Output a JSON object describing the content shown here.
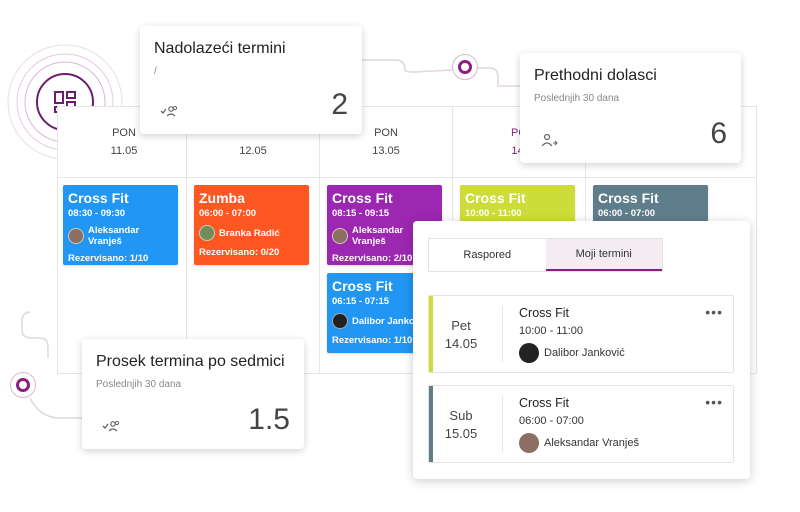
{
  "calendar": {
    "days": [
      {
        "name": "PON",
        "date": "11.05"
      },
      {
        "name": "",
        "date": "12.05"
      },
      {
        "name": "PON",
        "date": "13.05"
      },
      {
        "name": "PO",
        "date": "14."
      },
      {
        "name": "",
        "date": ""
      }
    ],
    "events": [
      {
        "title": "Cross Fit",
        "time": "08:30 - 09:30",
        "trainer": "Aleksandar Vranješ",
        "reserved": "Rezervisano: 1/10",
        "color": "#2196f3"
      },
      {
        "title": "Zumba",
        "time": "06:00 - 07:00",
        "trainer": "Branka Radić",
        "reserved": "Rezervisano: 0/20",
        "color": "#ff5722"
      },
      {
        "title": "Cross Fit",
        "time": "08:15 - 09:15",
        "trainer": "Aleksandar Vranješ",
        "reserved": "Rezervisano: 2/10",
        "color": "#9c27b0"
      },
      {
        "title": "Cross Fit",
        "time": "06:15 - 07:15",
        "trainer": "Dalibor Janković",
        "reserved": "Rezervisano: 1/10",
        "color": "#2196f3"
      },
      {
        "title": "Cross Fit",
        "time": "10:00 - 11:00",
        "color": "#cddc39"
      },
      {
        "title": "Cross Fit",
        "time": "06:00 - 07:00",
        "color": "#607d8b"
      }
    ]
  },
  "cards": {
    "upcoming": {
      "title": "Nadolazeći termini",
      "subtitle": "/",
      "value": "2",
      "icon": "group-check-icon"
    },
    "previous": {
      "title": "Prethodni dolasci",
      "subtitle": "Poslednjih 30 dana",
      "value": "6",
      "icon": "person-arrow-icon"
    },
    "average": {
      "title": "Prosek termina po sedmici",
      "subtitle": "Poslednjih 30 dana",
      "value": "1.5",
      "icon": "group-check-icon"
    }
  },
  "panel": {
    "tabs": [
      "Raspored",
      "Moji termini"
    ],
    "active_tab": "Moji termini",
    "appointments": [
      {
        "weekday": "Pet",
        "date": "14.05",
        "title": "Cross Fit",
        "time": "10:00 - 11:00",
        "trainer": "Dalibor Janković",
        "more": "•••",
        "bar_color": "#cddc39"
      },
      {
        "weekday": "Sub",
        "date": "15.05",
        "title": "Cross Fit",
        "time": "06:00 - 07:00",
        "trainer": "Aleksandar Vranješ",
        "more": "•••",
        "bar_color": "#607d8b"
      }
    ]
  },
  "colors": {
    "accent": "#8a1f80"
  },
  "logo_icon": "dashboard-grid-icon"
}
